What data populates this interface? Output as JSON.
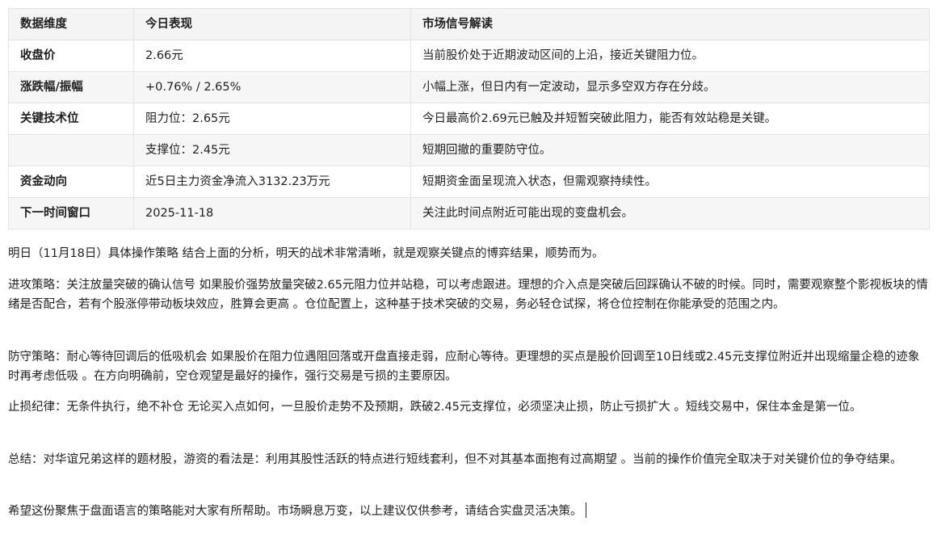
{
  "table": {
    "headers": [
      "数据维度",
      "今日表现",
      "市场信号解读"
    ],
    "rows": [
      {
        "dimension": "收盘价",
        "performance": "2.66元",
        "interpretation": "当前股价处于近期波动区间的上沿，接近关键阻力位。"
      },
      {
        "dimension": "涨跌幅/振幅",
        "performance": "+0.76% / 2.65%",
        "interpretation": "小幅上涨，但日内有一定波动，显示多空双方存在分歧。"
      },
      {
        "dimension": "关键技术位",
        "performance": "阻力位：2.65元",
        "interpretation": "今日最高价2.69元已触及并短暂突破此阻力，能否有效站稳是关键。"
      },
      {
        "dimension": "",
        "performance": "支撑位：2.45元",
        "interpretation": "短期回撤的重要防守位。"
      },
      {
        "dimension": "资金动向",
        "performance": "近5日主力资金净流入3132.23万元",
        "interpretation": "短期资金面呈现流入状态，但需观察持续性。"
      },
      {
        "dimension": "下一时间窗口",
        "performance": "2025-11-18",
        "interpretation": "关注此时间点附近可能出现的变盘机会。"
      }
    ]
  },
  "paragraphs": {
    "intro": "明日（11月18日）具体操作策略 结合上面的分析，明天的战术非常清晰，就是观察关键点的博弈结果，顺势而为。",
    "attack": "进攻策略：关注放量突破的确认信号 如果股价强势放量突破2.65元阻力位并站稳，可以考虑跟进。理想的介入点是突破后回踩确认不破的时候。同时，需要观察整个影视板块的情绪是否配合，若有个股涨停带动板块效应，胜算会更高 。仓位配置上，这种基于技术突破的交易，务必轻仓试探，将仓位控制在你能承受的范围之内。",
    "defense": " 防守策略：耐心等待回调后的低吸机会 如果股价在阻力位遇阻回落或开盘直接走弱，应耐心等待。更理想的买点是股价回调至10日线或2.45元支撑位附近并出现缩量企稳的迹象时再考虑低吸 。在方向明确前，空仓观望是最好的操作，强行交易是亏损的主要原因。",
    "stoploss": " 止损纪律：无条件执行，绝不补仓 无论买入点如何，一旦股价走势不及预期，跌破2.45元支撑位，必须坚决止损，防止亏损扩大 。短线交易中，保住本金是第一位。",
    "summary": "总结：对华谊兄弟这样的题材股，游资的看法是：利用其股性活跃的特点进行短线套利，但不对其基本面抱有过高期望 。当前的操作价值完全取决于对关键价位的争夺结果。",
    "closing": " 希望这份聚焦于盘面语言的策略能对大家有所帮助。市场瞬息万变，以上建议仅供参考，请结合实盘灵活决策。"
  }
}
